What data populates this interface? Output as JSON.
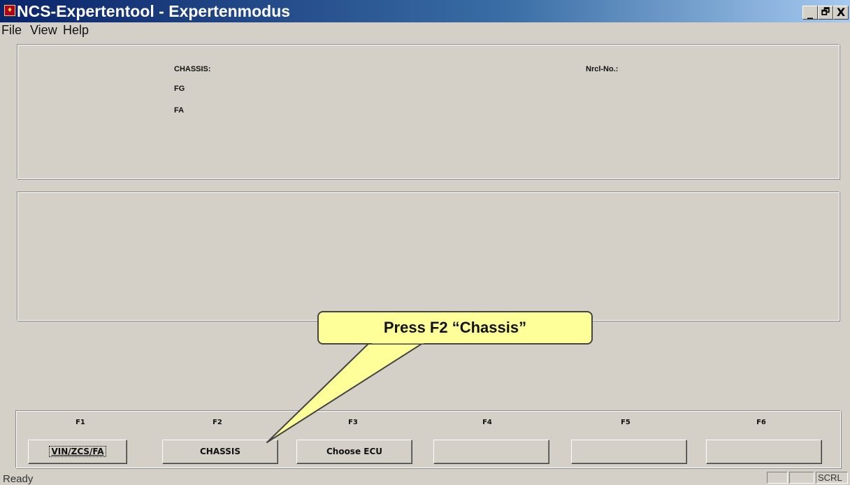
{
  "window": {
    "title": "NCS-Expertentool - Expertenmodus",
    "icon": "app-icon",
    "controls": [
      "_",
      "🗗",
      "X"
    ]
  },
  "menu": {
    "items": [
      "File",
      "View",
      "Help"
    ]
  },
  "info_panel": {
    "chassis_label": "CHASSIS:",
    "fg_label": "FG",
    "fa_label": "FA",
    "nrcl_label": "Nrcl-No.:"
  },
  "function_keys": [
    {
      "key": "F1",
      "label": "VIN/ZCS/FA"
    },
    {
      "key": "F2",
      "label": "CHASSIS"
    },
    {
      "key": "F3",
      "label": "Choose ECU"
    },
    {
      "key": "F4",
      "label": ""
    },
    {
      "key": "F5",
      "label": ""
    },
    {
      "key": "F6",
      "label": ""
    }
  ],
  "callout": {
    "text": "Press F2 “Chassis”",
    "color": "#ffff99"
  },
  "status": {
    "text": "Ready",
    "indicator": "SCRL"
  }
}
